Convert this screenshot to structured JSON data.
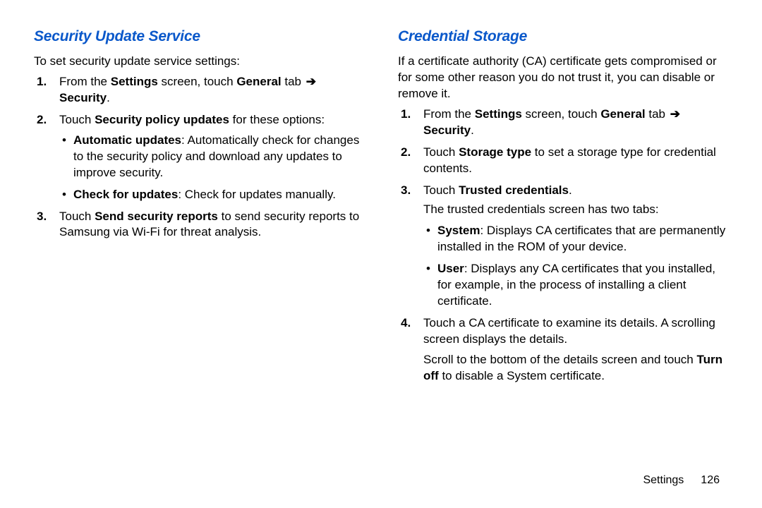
{
  "left": {
    "heading": "Security Update Service",
    "intro": "To set security update service settings:",
    "steps": {
      "s1_prefix": "From the ",
      "s1_b1": "Settings",
      "s1_mid": " screen, touch ",
      "s1_b2": "General",
      "s1_mid2": " tab ",
      "s1_arrow": "➔",
      "s1_b3": "Security",
      "s1_end": ".",
      "s2_prefix": "Touch ",
      "s2_b1": "Security policy updates",
      "s2_end": " for these options:",
      "bullets": {
        "b1_label": "Automatic updates",
        "b1_text": ": Automatically check for changes to the security policy and download any updates to improve security.",
        "b2_label": "Check for updates",
        "b2_text": ": Check for updates manually."
      },
      "s3_prefix": "Touch ",
      "s3_b1": "Send security reports",
      "s3_end": " to send security reports to Samsung via Wi-Fi for threat analysis."
    }
  },
  "right": {
    "heading": "Credential Storage",
    "intro": "If a certificate authority (CA) certificate gets compromised or for some other reason you do not trust it, you can disable or remove it.",
    "steps": {
      "s1_prefix": "From the ",
      "s1_b1": "Settings",
      "s1_mid": " screen, touch ",
      "s1_b2": "General",
      "s1_mid2": " tab ",
      "s1_arrow": "➔",
      "s1_b3": "Security",
      "s1_end": ".",
      "s2_prefix": "Touch ",
      "s2_b1": "Storage type",
      "s2_end": " to set a storage type for credential contents.",
      "s3_prefix": "Touch ",
      "s3_b1": "Trusted credentials",
      "s3_end": ".",
      "s3_follow": "The trusted credentials screen has two tabs:",
      "bullets": {
        "b1_label": "System",
        "b1_text": ": Displays CA certificates that are permanently installed in the ROM of your device.",
        "b2_label": "User",
        "b2_text": ": Displays any CA certificates that you installed, for example, in the process of installing a client certificate."
      },
      "s4_text": "Touch a CA certificate to examine its details. A scrolling screen displays the details.",
      "s4_follow_pre": "Scroll to the bottom of the details screen and touch ",
      "s4_follow_b": "Turn off",
      "s4_follow_post": " to disable a System certificate."
    }
  },
  "footer": {
    "label": "Settings",
    "page": "126"
  }
}
